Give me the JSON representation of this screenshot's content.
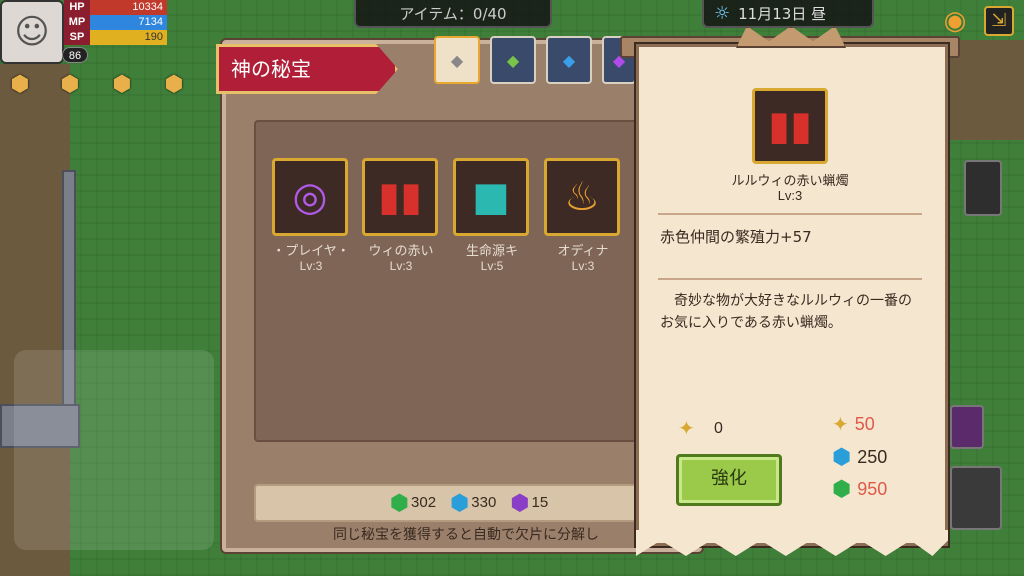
{
  "hud": {
    "avatar_icon": "character-portrait-icon",
    "stats": [
      {
        "label": "HP",
        "value": "10334",
        "color": "#c0392b"
      },
      {
        "label": "MP",
        "value": "7134",
        "color": "#2e86de"
      },
      {
        "label": "SP",
        "value": "190",
        "color": "#e0b020"
      }
    ],
    "level": "86",
    "item_capacity": "アイテム：0/40",
    "date": "11月13日 昼"
  },
  "panel": {
    "title": "神の秘宝",
    "tabs": [
      {
        "icon": "white-gem-icon",
        "active": true
      },
      {
        "icon": "green-gem-icon",
        "active": false
      },
      {
        "icon": "blue-gem-icon",
        "active": false
      },
      {
        "icon": "purple-gem-icon",
        "active": false
      }
    ],
    "items": [
      {
        "name": "・プレイヤ・",
        "level": "Lv:3",
        "icon": "disc-icon"
      },
      {
        "name": "ウィの赤い",
        "level": "Lv:3",
        "icon": "red-candle-icon"
      },
      {
        "name": "生命源キ",
        "level": "Lv:5",
        "icon": "teal-cube-icon"
      },
      {
        "name": "オディナ",
        "level": "Lv:3",
        "icon": "torch-icon"
      }
    ],
    "resources": [
      {
        "icon": "green-gem-icon",
        "value": "302",
        "color": "#2fae4a"
      },
      {
        "icon": "blue-gem-icon",
        "value": "330",
        "color": "#2a9ed8"
      },
      {
        "icon": "purple-gem-icon",
        "value": "15",
        "color": "#8a3ec8"
      }
    ],
    "footer_note": "同じ秘宝を獲得すると自動で欠片に分解し"
  },
  "detail": {
    "name": "ルルウィの赤い蝋燭",
    "level": "Lv:3",
    "effect": "赤色仲間の繁殖力+57",
    "description": "奇妙な物が大好きなルルウィの一番のお気に入りである赤い蝋燭。",
    "owned_pieces": "0",
    "costs": [
      {
        "icon": "gold-puzzle-icon",
        "value": "50",
        "color": "#e05a4a"
      },
      {
        "icon": "blue-gem-icon",
        "value": "250",
        "color": "#3a2a20"
      },
      {
        "icon": "green-gem-icon",
        "value": "950",
        "color": "#e05a4a"
      }
    ],
    "enhance_label": "強化"
  }
}
